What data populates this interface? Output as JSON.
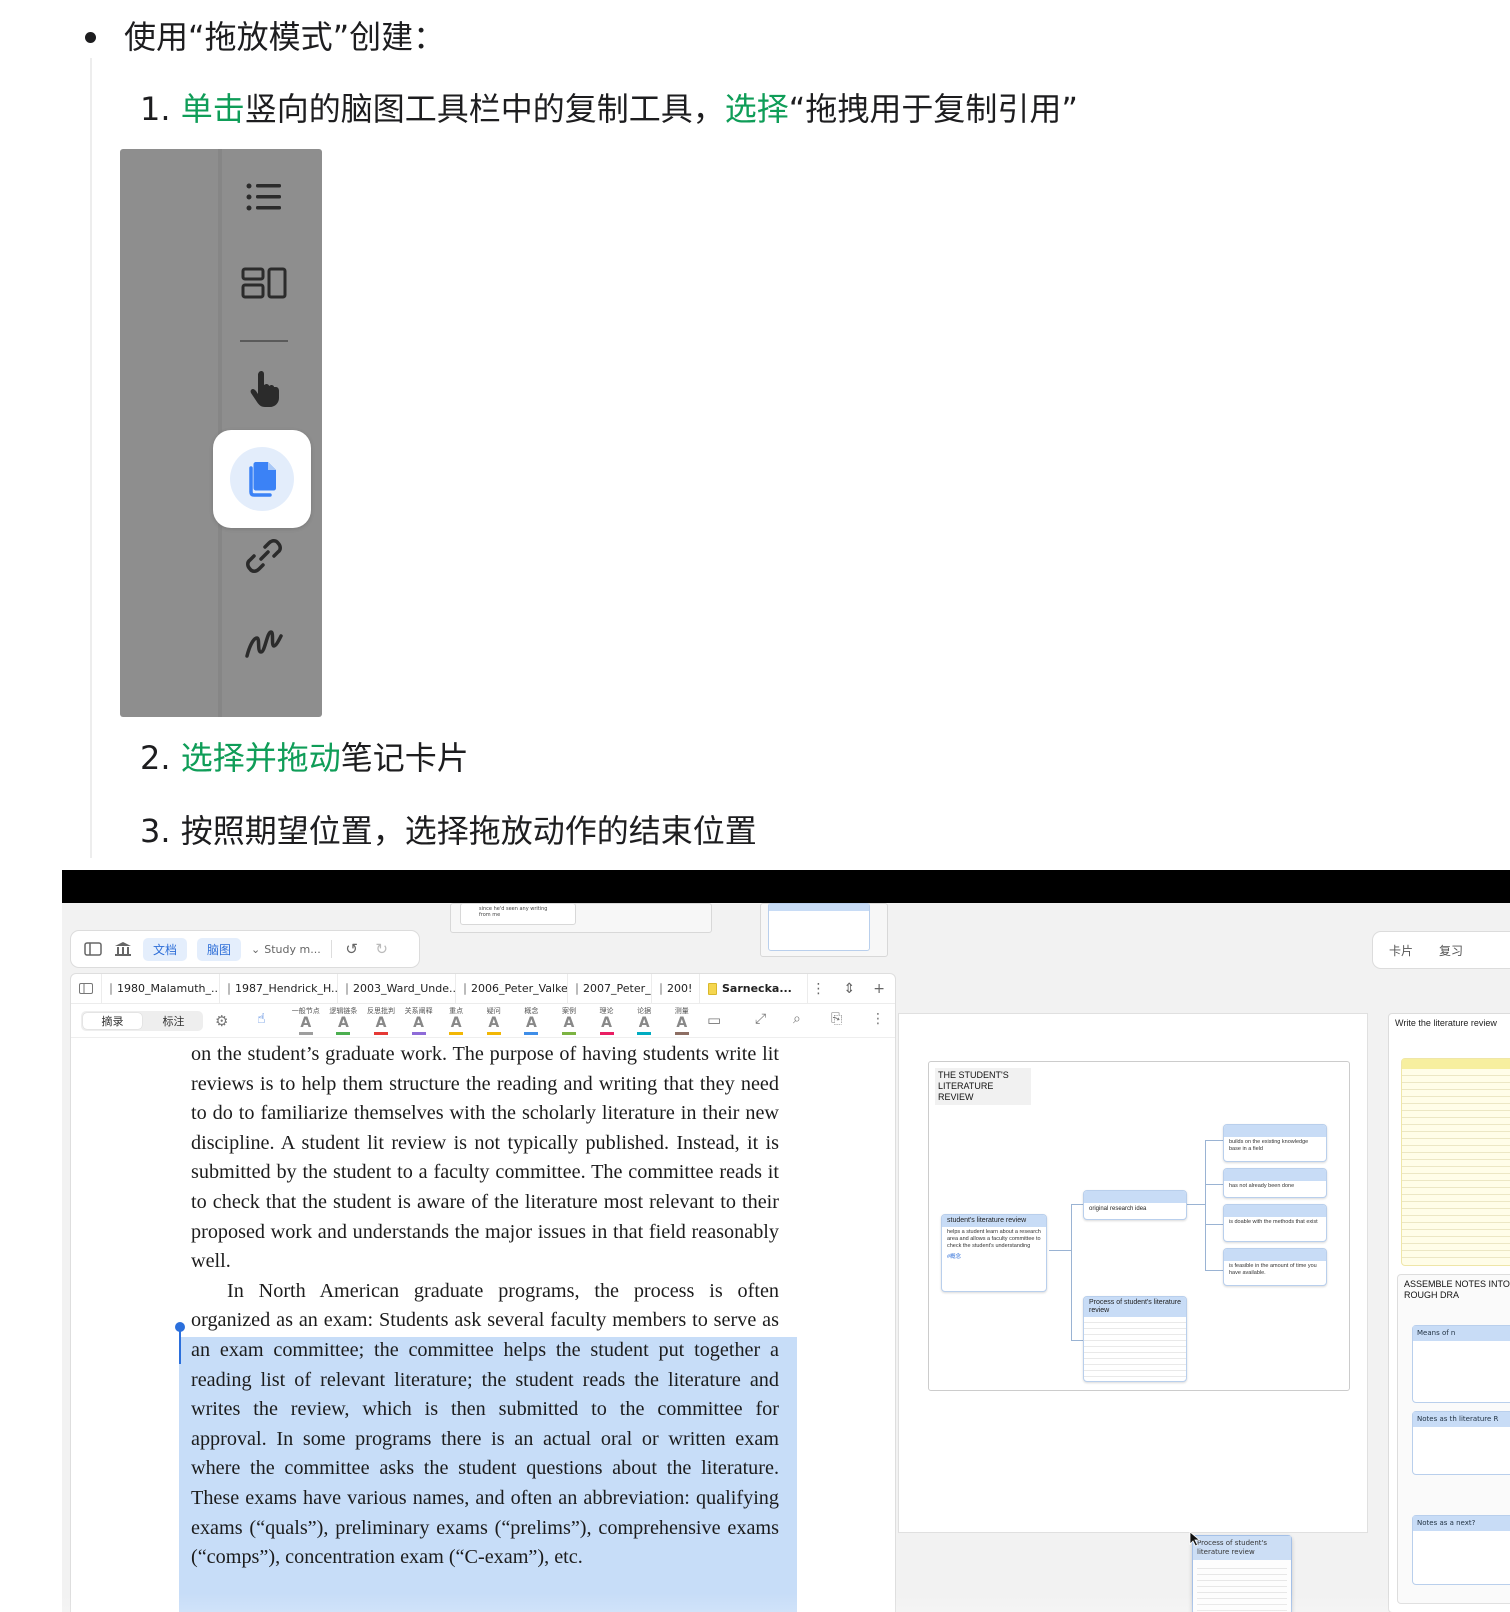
{
  "instructions": {
    "bullet": "使用“拖放模式”创建：",
    "step1": {
      "num": "1.",
      "action1": "单击",
      "text1": "竖向的脑图工具栏中的复制工具，",
      "action2": "选择",
      "text2": "“拖拽用于复制引用”"
    },
    "step2": {
      "num": "2.",
      "action": "选择并拖动",
      "text": "笔记卡片"
    },
    "step3": {
      "num": "3.",
      "text": "按照期望位置，选择拖放动作的结束位置"
    }
  },
  "vertical_toolbar": {
    "icons": [
      "list-icon",
      "layout-icon",
      "hand-pointer-icon",
      "copy-icon",
      "link-icon",
      "freehand-icon"
    ],
    "selected": "copy-icon",
    "accent": "#3b82f6"
  },
  "app": {
    "top_toolbar": {
      "tab_doc": "文档",
      "tab_mindmap": "脑图",
      "notebook": "Study m..."
    },
    "right_toolbar": {
      "cards": "卡片",
      "review": "复习"
    },
    "floating_card_text": "since he'd seen any writing from me",
    "tabs": [
      "1980_Malamuth_...",
      "1987_Hendrick_H...",
      "2003_Ward_Unde...",
      "2006_Peter_Valke",
      "2007_Peter_",
      "200!",
      "Sarnecka..."
    ],
    "active_tab": "Sarnecka...",
    "segment": {
      "excerpt": "摘录",
      "annotate": "标注"
    },
    "annotation_tools": [
      {
        "label": "一般节点",
        "color": "#9e9e9e"
      },
      {
        "label": "逻辑链条",
        "color": "#4caf50"
      },
      {
        "label": "反思批判",
        "color": "#e53935"
      },
      {
        "label": "关系阐释",
        "color": "#8e6bd8"
      },
      {
        "label": "重点",
        "color": "#f2b705"
      },
      {
        "label": "疑问",
        "color": "#f2b705"
      },
      {
        "label": "概念",
        "color": "#3f8ee8"
      },
      {
        "label": "案例",
        "color": "#7cb342"
      },
      {
        "label": "理论",
        "color": "#e91e63"
      },
      {
        "label": "论据",
        "color": "#00acc1"
      },
      {
        "label": "测量",
        "color": "#8d6e63"
      }
    ],
    "reader_text_before": "on the student’s graduate work. The purpose of having students write lit reviews is to help them structure the reading and writing that they need to do to familiarize themselves with the scholarly literature in their new discipline. A student lit review is not typically published. Instead, it is submitted by the student to a faculty committee. The committee reads it to check that the student is aware of the literature most relevant to their proposed work and understands the major issues in that field reasonably well.",
    "reader_text_highlight": "In North American graduate programs, the process is often organized as an exam: Students ask several faculty members to serve as an exam committee; the committee helps the student put together a reading list of relevant literature; the student reads the literature and writes the review, which is then submitted to the committee for approval. In some programs there is an actual oral or written exam where the committee asks the student questions about the literature. These exams have various names, and often an abbreviation: qualifying exams (“quals”), preliminary exams (“prelims”), comprehensive exams (“comps”), concentration exam (“C-exam”), etc.",
    "mindmap": {
      "title": "THE STUDENT'S LITERATURE REVIEW",
      "root": {
        "title": "student's literature review",
        "body": "helps a student learn about a research area and allows a faculty committee to check the student's understanding",
        "tag": "#概念"
      },
      "idea": "original research idea",
      "process": "Process of student's literature review",
      "leaves": [
        "builds on the existing knowledge base in a field",
        "has not already been done",
        "is doable with the methods that exist",
        "is feasible in the amount of time you have available."
      ]
    },
    "right_column": {
      "head": "Write the literature review",
      "assemble": "ASSEMBLE NOTES INTO ROUGH DRA",
      "items": [
        "Means of n",
        "Notes as th literature R",
        "Notes as a next?"
      ]
    },
    "dragging_card": "Process of student's literature review"
  }
}
